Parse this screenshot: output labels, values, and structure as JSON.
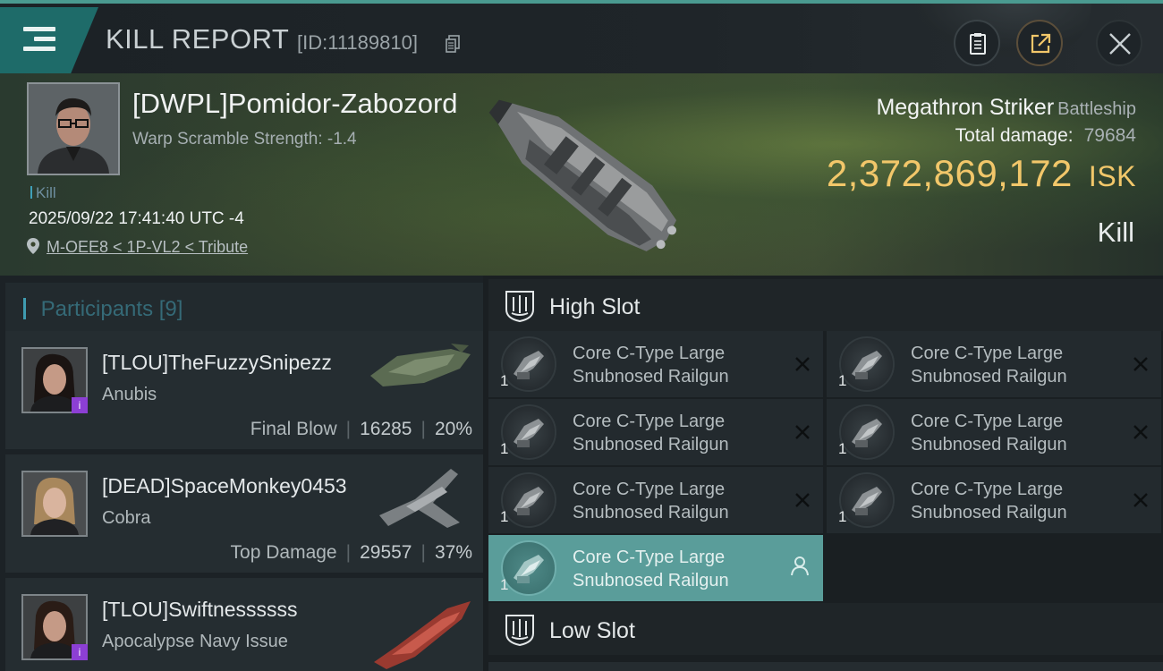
{
  "header": {
    "title": "KILL REPORT",
    "report_id": "[ID:11189810]",
    "icons": [
      "menu-icon",
      "copy-icon",
      "clipboard-icon",
      "share-icon",
      "close-icon"
    ]
  },
  "victim": {
    "name": "[DWPL]Pomidor-Zabozord",
    "warp_scramble": "Warp Scramble Strength: -1.4",
    "tag": "Kill",
    "datetime": "2025/09/22 17:41:40 UTC -4",
    "location": "M-OEE8 < 1P-VL2 < Tribute",
    "ship_name": "Megathron Striker",
    "ship_class": "Battleship",
    "total_damage_label": "Total damage:",
    "total_damage": "79684",
    "isk_value": "2,372,869,172",
    "isk_unit": "ISK",
    "result": "Kill"
  },
  "participants": {
    "title": "Participants",
    "count": "[9]",
    "items": [
      {
        "name": "[TLOU]TheFuzzySnipezz",
        "ship": "Anubis",
        "role": "Final Blow",
        "damage": "16285",
        "percent": "20%",
        "badge": "i"
      },
      {
        "name": "[DEAD]SpaceMonkey0453",
        "ship": "Cobra",
        "role": "Top Damage",
        "damage": "29557",
        "percent": "37%"
      },
      {
        "name": "[TLOU]Swiftnessssss",
        "ship": "Apocalypse Navy Issue",
        "badge": "i"
      }
    ]
  },
  "slots": {
    "high_label": "High Slot",
    "low_label": "Low Slot",
    "high": [
      {
        "qty": "1",
        "line1": "Core C-Type Large",
        "line2": "Snubnosed Railgun"
      },
      {
        "qty": "1",
        "line1": "Core C-Type Large",
        "line2": "Snubnosed Railgun"
      },
      {
        "qty": "1",
        "line1": "Core C-Type Large",
        "line2": "Snubnosed Railgun"
      },
      {
        "qty": "1",
        "line1": "Core C-Type Large",
        "line2": "Snubnosed Railgun"
      },
      {
        "qty": "1",
        "line1": "Core C-Type Large",
        "line2": "Snubnosed Railgun"
      },
      {
        "qty": "1",
        "line1": "Core C-Type Large",
        "line2": "Snubnosed Railgun"
      },
      {
        "qty": "1",
        "line1": "Core C-Type Large",
        "line2": "Snubnosed Railgun"
      }
    ]
  },
  "colors": {
    "accent_teal": "#1e6b69",
    "isk_gold": "#f2c76a",
    "active_module": "#5a9d9a",
    "badge_purple": "#8c3fd4"
  }
}
